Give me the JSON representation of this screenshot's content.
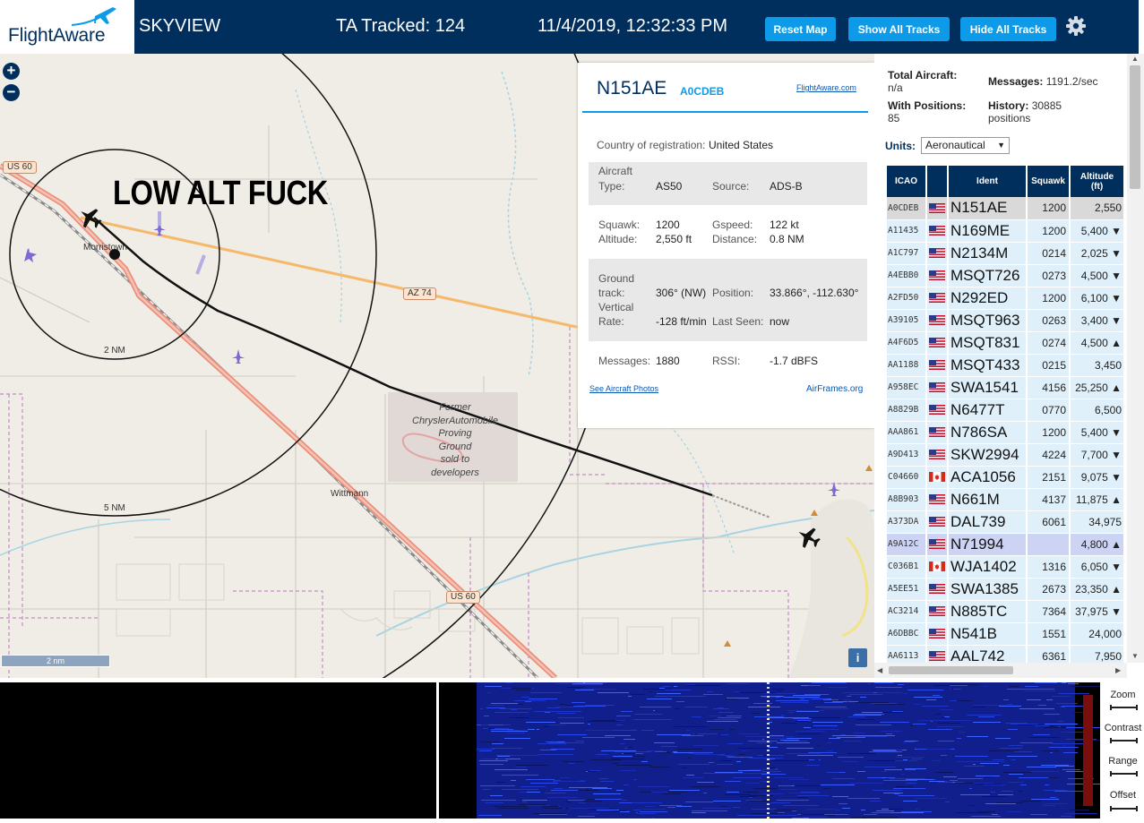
{
  "header": {
    "logo_text": "FlightAware",
    "title": "SKYVIEW",
    "tracked_label": "TA Tracked:",
    "tracked_value": "124",
    "clock": "11/4/2019, 12:32:33 PM",
    "reset_label": "Reset Map",
    "show_label": "Show All Tracks",
    "hide_label": "Hide All Tracks",
    "accent_color": "#0d9ae8",
    "bar_color": "#002f5d"
  },
  "map": {
    "zoom_in": "+",
    "zoom_out": "−",
    "annotation": "LOW ALT FUCK",
    "town_morristown": "Morristown",
    "town_wittmann": "Wittmann",
    "ring_inner": "2 NM",
    "ring_outer": "5 NM",
    "shield_us60_top": "US 60",
    "shield_az74": "AZ 74",
    "shield_us60_bottom": "US 60",
    "proving_ground": [
      "Former",
      "ChryslerAutomobile",
      "Proving",
      "Ground",
      "sold to",
      "developers"
    ],
    "scale_bar": "2 nm",
    "info": "i"
  },
  "popup": {
    "ident": "N151AE",
    "hex": "A0CDEB",
    "fa_link": "FlightAware.com",
    "country_label": "Country of registration:",
    "country_value": "United States",
    "aircraft_type_label_1": "Aircraft",
    "aircraft_type_label_2": "Type:",
    "aircraft_type": "AS50",
    "source_label": "Source:",
    "source": "ADS-B",
    "squawk_label": "Squawk:",
    "squawk": "1200",
    "gspeed_label": "Gspeed:",
    "gspeed": "122 kt",
    "altitude_label": "Altitude:",
    "altitude": "2,550 ft",
    "distance_label": "Distance:",
    "distance": "0.8 NM",
    "ground_label_1": "Ground",
    "ground_label_2": "track:",
    "ground_track": "306° (NW)",
    "position_label": "Position:",
    "position": "33.866°, -112.630°",
    "vrate_label_1": "Vertical",
    "vrate_label_2": "Rate:",
    "vertical_rate": "-128 ft/min",
    "last_seen_label": "Last Seen:",
    "last_seen": "now",
    "messages_label": "Messages:",
    "messages": "1880",
    "rssi_label": "RSSI:",
    "rssi": "-1.7 dBFS",
    "photos_link": "See Aircraft Photos",
    "airframes_link": "AirFrames.org"
  },
  "sidebar": {
    "total_label": "Total Aircraft:",
    "total_value": "n/a",
    "messages_label": "Messages:",
    "messages_value": "1191.2/sec",
    "positions_label": "With Positions:",
    "positions_value": "85",
    "history_label": "History:",
    "history_value": "30885",
    "history_unit": "positions",
    "units_label": "Units:",
    "units_value": "Aeronautical",
    "columns": {
      "icao": "ICAO",
      "ident": "Ident",
      "squawk": "Squawk",
      "altitude_1": "Altitude",
      "altitude_2": "(ft)"
    },
    "rows": [
      {
        "icao": "A0CDEB",
        "flag": "us",
        "ident": "N151AE",
        "squawk": "1200",
        "altitude": "2,550",
        "trend": "",
        "state": "sel"
      },
      {
        "icao": "A11435",
        "flag": "us",
        "ident": "N169ME",
        "squawk": "1200",
        "altitude": "5,400",
        "trend": "▼",
        "state": ""
      },
      {
        "icao": "A1C797",
        "flag": "us",
        "ident": "N2134M",
        "squawk": "0214",
        "altitude": "2,025",
        "trend": "▼",
        "state": ""
      },
      {
        "icao": "A4EBB0",
        "flag": "us",
        "ident": "MSQT726",
        "squawk": "0273",
        "altitude": "4,500",
        "trend": "▼",
        "state": ""
      },
      {
        "icao": "A2FD50",
        "flag": "us",
        "ident": "N292ED",
        "squawk": "1200",
        "altitude": "6,100",
        "trend": "▼",
        "state": ""
      },
      {
        "icao": "A39105",
        "flag": "us",
        "ident": "MSQT963",
        "squawk": "0263",
        "altitude": "3,400",
        "trend": "▼",
        "state": ""
      },
      {
        "icao": "A4F6D5",
        "flag": "us",
        "ident": "MSQT831",
        "squawk": "0274",
        "altitude": "4,500",
        "trend": "▲",
        "state": ""
      },
      {
        "icao": "AA1188",
        "flag": "us",
        "ident": "MSQT433",
        "squawk": "0215",
        "altitude": "3,450",
        "trend": "",
        "state": ""
      },
      {
        "icao": "A958EC",
        "flag": "us",
        "ident": "SWA1541",
        "squawk": "4156",
        "altitude": "25,250",
        "trend": "▲",
        "state": ""
      },
      {
        "icao": "A8829B",
        "flag": "us",
        "ident": "N6477T",
        "squawk": "0770",
        "altitude": "6,500",
        "trend": "",
        "state": ""
      },
      {
        "icao": "AAA861",
        "flag": "us",
        "ident": "N786SA",
        "squawk": "1200",
        "altitude": "5,400",
        "trend": "▼",
        "state": ""
      },
      {
        "icao": "A9D413",
        "flag": "us",
        "ident": "SKW2994",
        "squawk": "4224",
        "altitude": "7,700",
        "trend": "▼",
        "state": ""
      },
      {
        "icao": "C04660",
        "flag": "ca",
        "ident": "ACA1056",
        "squawk": "2151",
        "altitude": "9,075",
        "trend": "▼",
        "state": ""
      },
      {
        "icao": "A8B903",
        "flag": "us",
        "ident": "N661M",
        "squawk": "4137",
        "altitude": "11,875",
        "trend": "▲",
        "state": ""
      },
      {
        "icao": "A373DA",
        "flag": "us",
        "ident": "DAL739",
        "squawk": "6061",
        "altitude": "34,975",
        "trend": "",
        "state": ""
      },
      {
        "icao": "A9A12C",
        "flag": "us",
        "ident": "N71994",
        "squawk": "",
        "altitude": "4,800",
        "trend": "▲",
        "state": "hl"
      },
      {
        "icao": "C036B1",
        "flag": "ca",
        "ident": "WJA1402",
        "squawk": "1316",
        "altitude": "6,050",
        "trend": "▼",
        "state": ""
      },
      {
        "icao": "A5EE51",
        "flag": "us",
        "ident": "SWA1385",
        "squawk": "2673",
        "altitude": "23,350",
        "trend": "▲",
        "state": ""
      },
      {
        "icao": "AC3214",
        "flag": "us",
        "ident": "N885TC",
        "squawk": "7364",
        "altitude": "37,975",
        "trend": "▼",
        "state": ""
      },
      {
        "icao": "A6DBBC",
        "flag": "us",
        "ident": "N541B",
        "squawk": "1551",
        "altitude": "24,000",
        "trend": "",
        "state": ""
      },
      {
        "icao": "AA6113",
        "flag": "us",
        "ident": "AAL742",
        "squawk": "6361",
        "altitude": "7,950",
        "trend": "",
        "state": ""
      }
    ]
  },
  "waterfall": {
    "zoom": "Zoom",
    "contrast": "Contrast",
    "range": "Range",
    "offset": "Offset"
  }
}
